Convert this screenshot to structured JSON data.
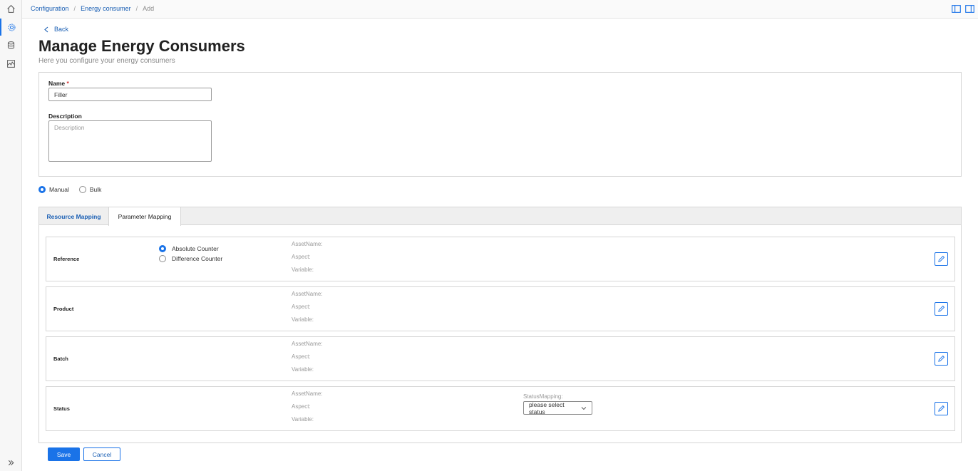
{
  "breadcrumb": {
    "items": [
      "Configuration",
      "Energy consumer"
    ],
    "current": "Add"
  },
  "back_label": "Back",
  "page": {
    "title": "Manage Energy Consumers",
    "subtitle": "Here you configure your energy consumers"
  },
  "form": {
    "name_label": "Name",
    "name_required_mark": "*",
    "name_value": "Filler",
    "description_label": "Description",
    "description_placeholder": "Description"
  },
  "modes": {
    "manual": "Manual",
    "bulk": "Bulk",
    "selected": "Manual"
  },
  "tabs": [
    "Resource Mapping",
    "Parameter Mapping"
  ],
  "active_tab": "Parameter Mapping",
  "rows": [
    {
      "label": "Reference",
      "asset": "AssetName:",
      "aspect": "Aspect:",
      "variable": "Variable:"
    },
    {
      "label": "Product",
      "asset": "AssetName:",
      "aspect": "Aspect:",
      "variable": "Variable:"
    },
    {
      "label": "Batch",
      "asset": "AssetName:",
      "aspect": "Aspect:",
      "variable": "Variable:"
    },
    {
      "label": "Status",
      "asset": "AssetName:",
      "aspect": "Aspect:",
      "variable": "Variable:"
    }
  ],
  "counter_options": {
    "absolute": "Absolute Counter",
    "difference": "Difference Counter",
    "selected": "Absolute Counter"
  },
  "status_mapping": {
    "label": "StatusMapping:",
    "placeholder": "please select status"
  },
  "actions": {
    "save": "Save",
    "cancel": "Cancel"
  },
  "colors": {
    "accent": "#1a73e8",
    "link": "#1a5fb4",
    "required": "#d32f2f"
  },
  "icons": {
    "rail": [
      "home-icon",
      "gear-icon",
      "database-icon",
      "chart-icon",
      "expand-icon"
    ],
    "top": [
      "left-panel-icon",
      "right-panel-icon"
    ],
    "row_action": "edit-icon"
  }
}
